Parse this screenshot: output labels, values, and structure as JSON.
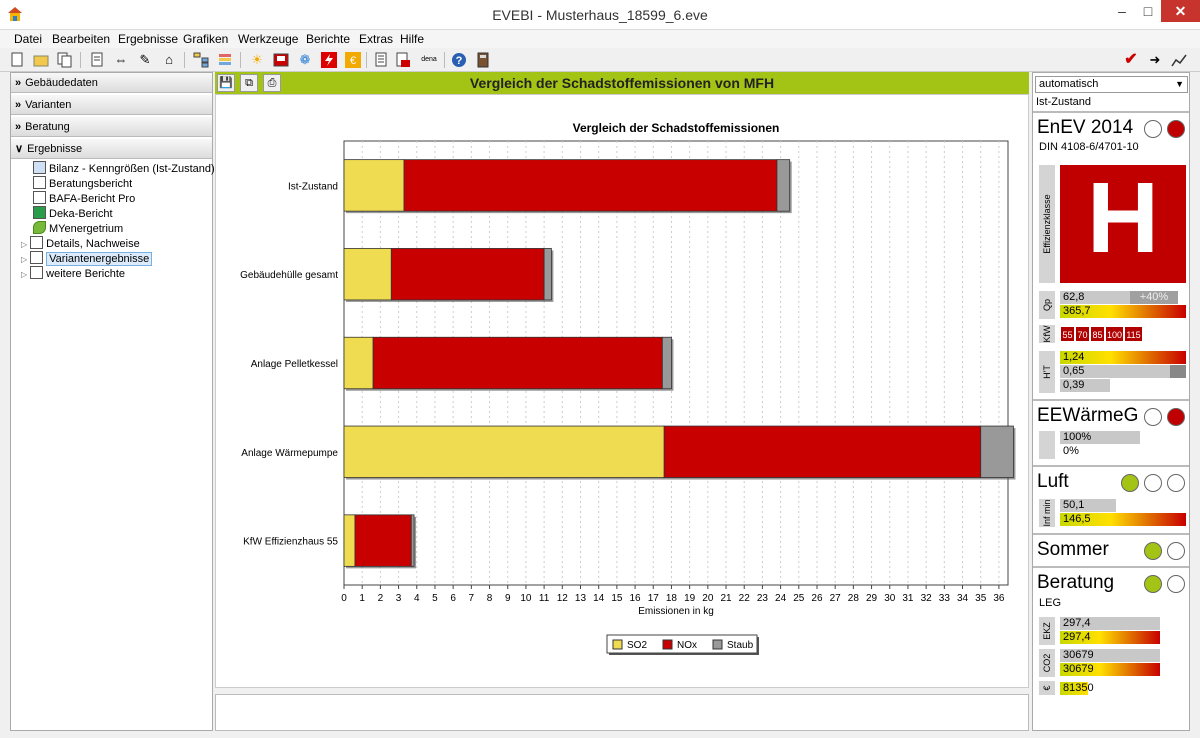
{
  "window": {
    "title": "EVEBI - Musterhaus_18599_6.eve"
  },
  "menu": [
    "Datei",
    "Bearbeiten",
    "Ergebnisse",
    "Grafiken",
    "Werkzeuge",
    "Berichte",
    "Extras",
    "Hilfe"
  ],
  "left": {
    "sections": [
      "Gebäudedaten",
      "Varianten",
      "Beratung",
      "Ergebnisse"
    ],
    "tree": [
      "Bilanz - Kenngrößen (Ist-Zustand)",
      "Beratungsbericht",
      "BAFA-Bericht Pro",
      "Deka-Bericht",
      "MYenergetrium",
      "Details, Nachweise",
      "Variantenergebnisse",
      "weitere Berichte"
    ]
  },
  "center": {
    "header": "Vergleich der Schadstoffemissionen von MFH"
  },
  "chart_data": {
    "type": "bar",
    "orientation": "horizontal",
    "stacked": true,
    "title": "Vergleich der Schadstoffemissionen",
    "xlabel": "Emissionen in kg",
    "ylabel": "",
    "xlim": [
      0,
      36.5
    ],
    "xticks": [
      0,
      1,
      2,
      3,
      4,
      5,
      6,
      7,
      8,
      9,
      10,
      11,
      12,
      13,
      14,
      15,
      16,
      17,
      18,
      19,
      20,
      21,
      22,
      23,
      24,
      25,
      26,
      27,
      28,
      29,
      30,
      31,
      32,
      33,
      34,
      35,
      36
    ],
    "categories": [
      "Ist-Zustand",
      "Gebäudehülle gesamt",
      "Anlage Pelletkessel",
      "Anlage Wärmepumpe",
      "KfW Effizienzhaus 55"
    ],
    "series": [
      {
        "name": "SO2",
        "color": "#f0dc50",
        "values": [
          3.3,
          2.6,
          1.6,
          17.6,
          0.6
        ]
      },
      {
        "name": "NOx",
        "color": "#c80000",
        "values": [
          20.5,
          8.4,
          15.9,
          17.4,
          3.1
        ]
      },
      {
        "name": "Staub",
        "color": "#999999",
        "values": [
          0.7,
          0.4,
          0.5,
          1.8,
          0.15
        ]
      }
    ],
    "grid": true,
    "legend": "bottom"
  },
  "right": {
    "dropdown": "automatisch",
    "state": "Ist-Zustand",
    "enev": {
      "title": "EnEV 2014",
      "sub": "DIN 4108-6/4701-10",
      "class": "H",
      "class_label": "Effizienzklasse",
      "qp_label": "Qp",
      "qp_values": [
        "62,8",
        "365,7"
      ],
      "qp_delta": "+40%",
      "kfw_label": "KfW",
      "kfw_levels": [
        "55",
        "70",
        "85",
        "100",
        "115"
      ],
      "ht_label": "H'T",
      "ht_values": [
        "1,24",
        "0,65",
        "0,39"
      ]
    },
    "eewg": {
      "title": "EEWärmeG",
      "values": [
        "100%",
        "0%"
      ]
    },
    "luft": {
      "title": "Luft",
      "label": "Inf min",
      "values": [
        "50,1",
        "146,5"
      ]
    },
    "sommer": {
      "title": "Sommer"
    },
    "beratung": {
      "title": "Beratung",
      "sub": "LEG",
      "ekz_label": "EKZ",
      "ekz": [
        "297,4",
        "297,4"
      ],
      "co2_label": "CO2",
      "co2": [
        "30679",
        "30679"
      ],
      "eur_label": "€",
      "eur": "81350"
    }
  }
}
